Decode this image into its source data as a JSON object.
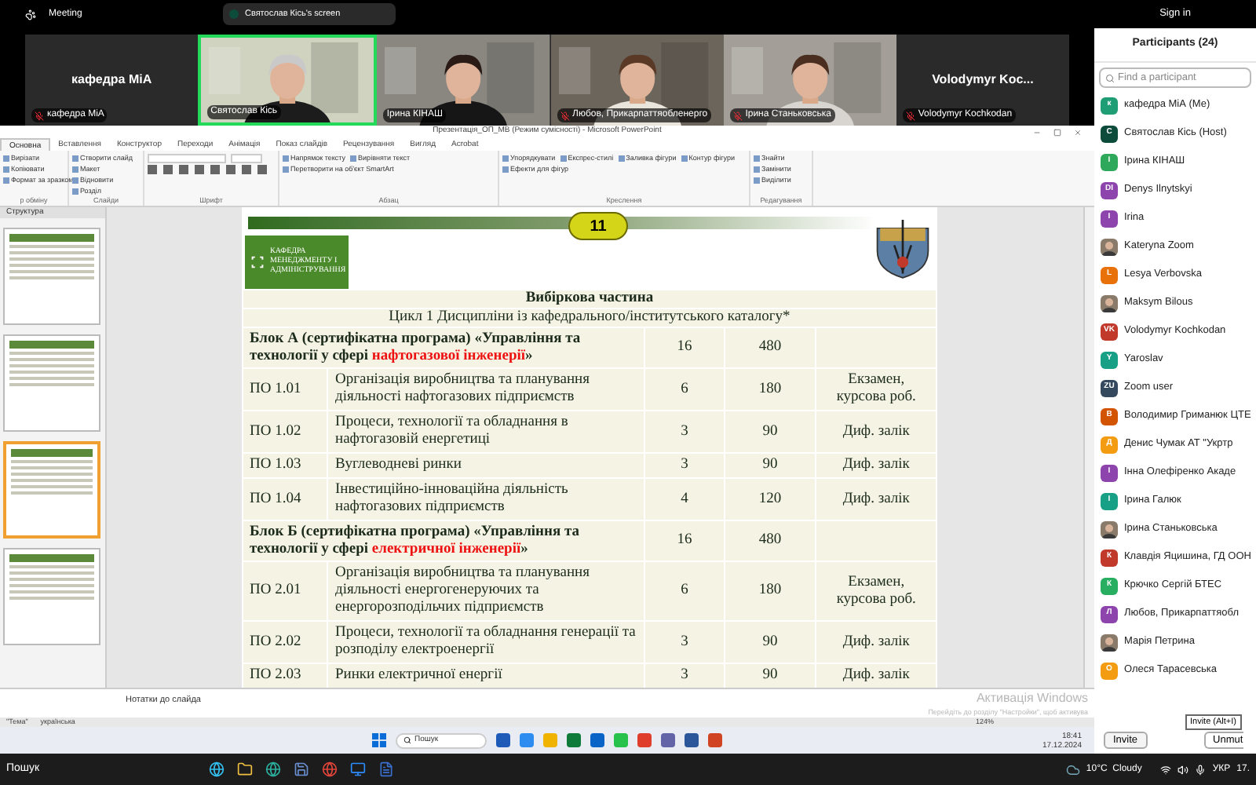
{
  "top_bar": {
    "title": "Meeting",
    "screen_label": "Святослав Кісь's screen",
    "sign_in": "Sign in"
  },
  "video_tiles": [
    {
      "kind": "name",
      "big_name": "кафедра МіА",
      "name": "кафедра МіА",
      "muted": true,
      "speaking": false
    },
    {
      "kind": "video",
      "name": "Святослав Кісь",
      "muted": false,
      "speaking": true
    },
    {
      "kind": "video",
      "name": "Ірина КІНАШ",
      "muted": false,
      "speaking": false
    },
    {
      "kind": "video",
      "name": "Любов, Прикарпаттяобленерго",
      "muted": true,
      "speaking": false
    },
    {
      "kind": "video",
      "name": "Ірина Станьковська",
      "muted": true,
      "speaking": false
    },
    {
      "kind": "name",
      "big_name": "Volodymyr  Koc...",
      "name": "Volodymyr Kochkodan",
      "muted": true,
      "speaking": false
    }
  ],
  "powerpoint": {
    "title": "Презентація_ОП_МВ (Режим сумісності) - Microsoft PowerPoint",
    "tabs": [
      {
        "label": "Основна",
        "selected": true
      },
      {
        "label": "Вставлення",
        "selected": false
      },
      {
        "label": "Конструктор",
        "selected": false
      },
      {
        "label": "Переходи",
        "selected": false
      },
      {
        "label": "Анімація",
        "selected": false
      },
      {
        "label": "Показ слайдів",
        "selected": false
      },
      {
        "label": "Рецензування",
        "selected": false
      },
      {
        "label": "Вигляд",
        "selected": false
      },
      {
        "label": "Acrobat",
        "selected": false
      }
    ],
    "groups": [
      {
        "label": "р обміну",
        "items": [
          "Вирізати",
          "Копіювати",
          "Формат за зразком"
        ]
      },
      {
        "label": "Слайди",
        "items": [
          "Створити слайд",
          "Макет",
          "Відновити",
          "Розділ"
        ]
      },
      {
        "label": "Шрифт"
      },
      {
        "label": "Абзац",
        "items": [
          "Напрямок тексту",
          "Вирівняти текст",
          "Перетворити на об'єкт SmartArt"
        ]
      },
      {
        "label": "Креслення",
        "items": [
          "Упорядкувати",
          "Експрес-стилі",
          "Заливка фігури",
          "Контур фігури",
          "Ефекти для фігур"
        ]
      },
      {
        "label": "Редагування",
        "items": [
          "Знайти",
          "Замінити",
          "Виділити"
        ]
      }
    ],
    "outline_tab": "Структура",
    "thumbnails": [
      {
        "selected": false
      },
      {
        "selected": false
      },
      {
        "selected": true
      },
      {
        "selected": false
      }
    ],
    "slide": {
      "number": "11",
      "dept_logo_text": "КАФЕДРА МЕНЕДЖМЕНТУ І АДМІНІСТРУВАННЯ",
      "heading": "Вибіркова частина",
      "subheading": "Цикл 1 Дисципліни із кафедрального/інститутського  каталогу*",
      "rows": [
        {
          "kind": "block",
          "title": "Блок А (сертифікатна програма) «Управління та технології у сфері ",
          "highlight": "нафтогазової інженерії",
          "title_end": "»",
          "credits": "16",
          "hours": "480"
        },
        {
          "kind": "course",
          "code": "ПО 1.01",
          "name": "Організація виробництва та планування діяльності  нафтогазових підприємств",
          "credits": "6",
          "hours": "180",
          "control": "Екзамен, курсова роб."
        },
        {
          "kind": "course",
          "code": "ПО 1.02",
          "name": "Процеси, технології та обладнання в нафтогазовій енергетиці",
          "credits": "3",
          "hours": "90",
          "control": "Диф. залік"
        },
        {
          "kind": "course",
          "code": "ПО 1.03",
          "name": "Вуглеводневі ринки",
          "credits": "3",
          "hours": "90",
          "control": "Диф. залік"
        },
        {
          "kind": "course",
          "code": "ПО 1.04",
          "name": "Інвестиційно-інноваційна діяльність нафтогазових підприємств",
          "credits": "4",
          "hours": "120",
          "control": "Диф. залік"
        },
        {
          "kind": "block",
          "title": "Блок Б (сертифікатна програма) «Управління та технології у сфері ",
          "highlight": "електричної інженерії",
          "title_end": "»",
          "credits": "16",
          "hours": "480"
        },
        {
          "kind": "course",
          "code": "ПО 2.01",
          "name": "Організація виробництва та планування діяльності  енергогенеруючих та енергорозподільчих  підприємств",
          "credits": "6",
          "hours": "180",
          "control": "Екзамен, курсова роб."
        },
        {
          "kind": "course",
          "code": "ПО 2.02",
          "name": "Процеси, технології та обладнання генерації та розподілу  електроенергії",
          "credits": "3",
          "hours": "90",
          "control": "Диф. залік"
        },
        {
          "kind": "course",
          "code": "ПО 2.03",
          "name": "Ринки електричної енергії",
          "credits": "3",
          "hours": "90",
          "control": "Диф. залік"
        }
      ]
    },
    "notes_placeholder": "Нотатки до слайда",
    "activation": [
      "Активація Windows",
      "Перейдіть до розділу \"Настройки\", щоб активува"
    ],
    "status": [
      "\"Тема\"",
      "українська",
      "124%"
    ],
    "taskbar": {
      "search": "Пошук",
      "time": "18:41",
      "date": "17.12.2024"
    }
  },
  "participants": {
    "title": "Participants (24)",
    "search_placeholder": "Find a participant",
    "people": [
      {
        "name": "кафедра МіА (Me)",
        "kind": "initials",
        "initials": "к",
        "color": "#1f9d74"
      },
      {
        "name": "Святослав Кісь (Host)",
        "kind": "initials",
        "initials": "С",
        "color": "#0d4b3b"
      },
      {
        "name": "Ірина КІНАШ",
        "kind": "initials",
        "initials": "І",
        "color": "#2ea85a"
      },
      {
        "name": "Denys Ilnytskyi",
        "kind": "initials",
        "initials": "DI",
        "color": "#8e44ad"
      },
      {
        "name": "Irina",
        "kind": "initials",
        "initials": "I",
        "color": "#8e44ad"
      },
      {
        "name": "Kateryna Zoom"
      },
      {
        "name": "Lesya Verbovska",
        "kind": "initials",
        "initials": "L",
        "color": "#e8710a"
      },
      {
        "name": "Maksym Bilous"
      },
      {
        "name": "Volodymyr Kochkodan",
        "kind": "initials",
        "initials": "VK",
        "color": "#c0392b"
      },
      {
        "name": "Yaroslav",
        "kind": "initials",
        "initials": "Y",
        "color": "#17a085"
      },
      {
        "name": "Zoom user",
        "kind": "initials",
        "initials": "ZU",
        "color": "#34495e"
      },
      {
        "name": "Володимир Гриманюк ЦТЕ",
        "kind": "initials",
        "initials": "В",
        "color": "#d35400"
      },
      {
        "name": "Денис Чумак АТ \"Укртр",
        "kind": "initials",
        "initials": "Д",
        "color": "#f39c12"
      },
      {
        "name": "Інна Олефіренко Акаде",
        "kind": "initials",
        "initials": "І",
        "color": "#8e44ad"
      },
      {
        "name": "Ірина Галюк",
        "kind": "initials",
        "initials": "І",
        "color": "#17a085"
      },
      {
        "name": "Ірина Станьковська"
      },
      {
        "name": "Клавдія Яцишина, ГД ООН",
        "kind": "initials",
        "initials": "К",
        "color": "#c0392b"
      },
      {
        "name": "Крючко Сергій БТЕС",
        "kind": "initials",
        "initials": "К",
        "color": "#27ae60"
      },
      {
        "name": "Любов, Прикарпаттяобл",
        "kind": "initials",
        "initials": "Л",
        "color": "#8e44ad"
      },
      {
        "name": "Марія Петрина"
      },
      {
        "name": "Олеся Тарасевська",
        "kind": "initials",
        "initials": "О",
        "color": "#f39c12"
      }
    ],
    "invite": "Invite",
    "unmute": "Unmut",
    "tooltip": "Invite (Alt+I)"
  },
  "taskbar": {
    "search": "Пошук",
    "weather": "10°C  Cloudy",
    "language": "УКР",
    "date": "17."
  }
}
